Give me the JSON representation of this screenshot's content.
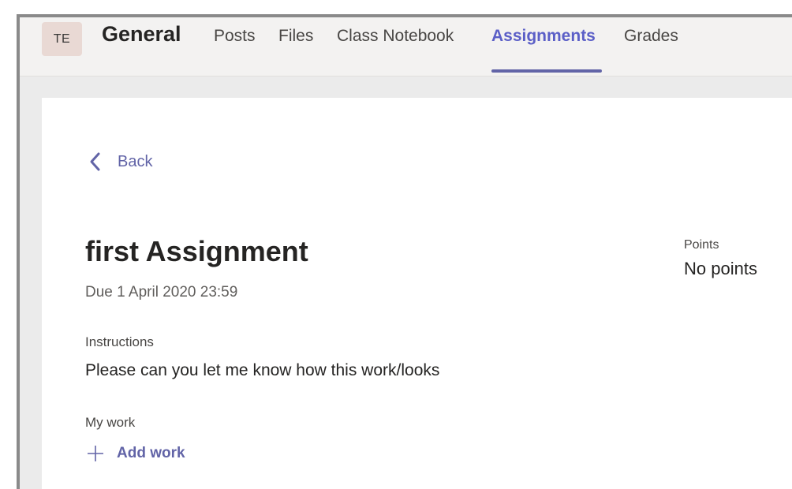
{
  "header": {
    "avatar_initials": "TE",
    "channel_title": "General",
    "tabs": [
      {
        "label": "Posts",
        "active": false
      },
      {
        "label": "Files",
        "active": false
      },
      {
        "label": "Class Notebook",
        "active": false
      },
      {
        "label": "Assignments",
        "active": true
      },
      {
        "label": "Grades",
        "active": false
      }
    ]
  },
  "assignment": {
    "back_label": "Back",
    "title": "first Assignment",
    "due": "Due 1 April 2020 23:59",
    "instructions_label": "Instructions",
    "instructions_text": "Please can you let me know how this work/looks",
    "my_work_label": "My work",
    "add_work_label": "Add work",
    "points_label": "Points",
    "points_value": "No points"
  },
  "icons": {
    "back": "chevron-left-icon",
    "add": "plus-icon"
  },
  "colors": {
    "accent": "#6264a7",
    "header_bg": "#f3f2f1",
    "page_bg": "#ebebeb",
    "avatar_bg": "#e9d9d4"
  }
}
